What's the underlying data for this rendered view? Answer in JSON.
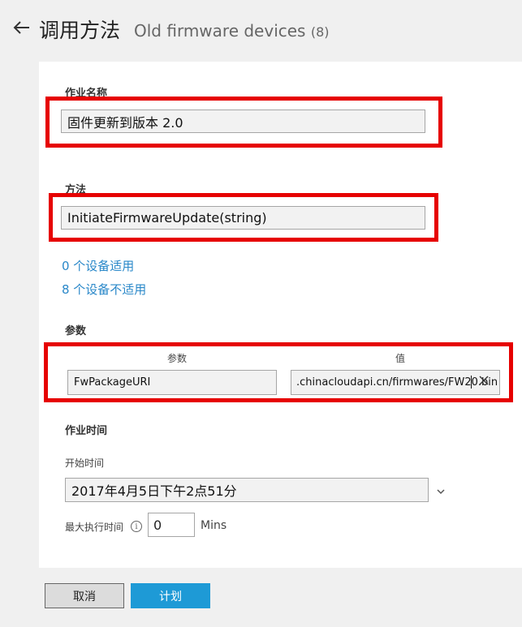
{
  "header": {
    "back_icon": "arrow-left-icon",
    "title": "调用方法",
    "subtitle": "Old firmware devices",
    "count": "(8)"
  },
  "job_name": {
    "label": "作业名称",
    "value": "固件更新到版本 2.0"
  },
  "method": {
    "label": "方法",
    "value": "InitiateFirmwareUpdate(string)"
  },
  "devices": {
    "applicable": "0 个设备适用",
    "not_applicable": "8 个设备不适用"
  },
  "params": {
    "label": "参数",
    "col_name": "参数",
    "col_value": "值",
    "name_value": "FwPackageURI",
    "value_value": ".chinacloudapi.cn/firmwares/FW20.bin",
    "clear_icon": "close-icon"
  },
  "job_time": {
    "label": "作业时间",
    "start_label": "开始时间",
    "start_value": "2017年4月5日下午2点51分",
    "dropdown_icon": "chevron-down-icon",
    "max_label": "最大执行时间",
    "info_icon": "info-icon",
    "max_value": "0",
    "unit": "Mins"
  },
  "buttons": {
    "cancel": "取消",
    "schedule": "计划"
  },
  "colors": {
    "accent": "#1e9ad6",
    "link": "#2a88c9",
    "highlight": "#e60000"
  }
}
